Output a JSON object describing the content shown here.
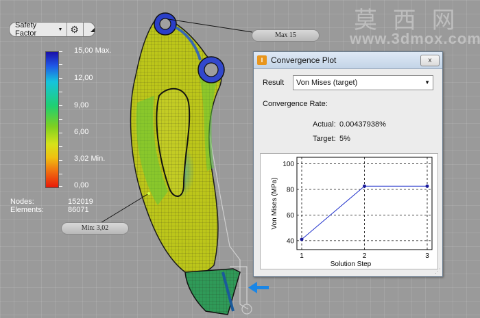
{
  "result_selector": {
    "label": "Safety Factor",
    "gear_icon": "gear-icon",
    "corner_icon": "resize-corner-icon"
  },
  "legend": {
    "labels": [
      "15,00 Max.",
      "12,00",
      "9,00",
      "6,00",
      "3,02 Min.",
      "0,00"
    ],
    "colors": {
      "max": "#1a10a8",
      "high": "#1f56e6",
      "mid_high": "#16c4dc",
      "mid": "#20d070",
      "mid_low": "#d6e21a",
      "low": "#f07010",
      "min": "#e81a0a"
    }
  },
  "stats": {
    "nodes_label": "Nodes:",
    "nodes_value": "152019",
    "elements_label": "Elements:",
    "elements_value": "86071"
  },
  "callouts": {
    "max": "Max 15",
    "min": "Min: 3,02"
  },
  "watermark": {
    "main": "莫 西 网",
    "url": "www.3dmox.com"
  },
  "dialog": {
    "title": "Convergence Plot",
    "close_label": "x",
    "result_label": "Result",
    "result_value": "Von Mises (target)",
    "convergence_rate_label": "Convergence Rate:",
    "actual_label": "Actual:",
    "actual_value": "0.00437938%",
    "target_label": "Target:",
    "target_value": "5%"
  },
  "chart_data": {
    "type": "line",
    "xlabel": "Solution Step",
    "ylabel": "Von Mises (MPa)",
    "x": [
      1,
      2,
      3
    ],
    "y": [
      41,
      82.5,
      82.5
    ],
    "xticks": [
      "1",
      "2",
      "3"
    ],
    "yticks": [
      "40",
      "60",
      "80",
      "100"
    ],
    "xlim": [
      1,
      3
    ],
    "ylim": [
      33,
      105
    ],
    "grid": true,
    "line_color": "#2233cc"
  }
}
